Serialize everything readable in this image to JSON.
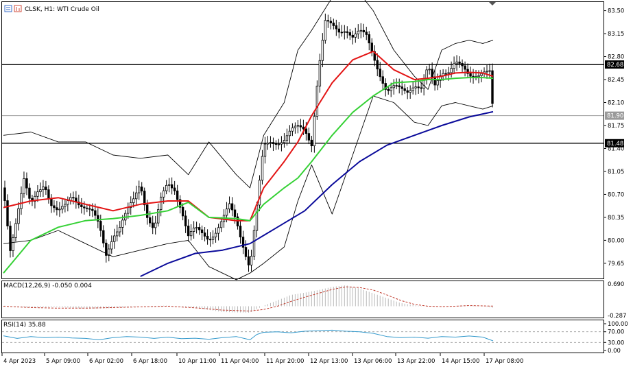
{
  "window": {
    "title": "CLSK, H1:  WTI Crude Oil",
    "icons": [
      "chart-toolbar-icon",
      "chart-bars-icon"
    ]
  },
  "price_scale": {
    "ticks": [
      "83.50",
      "83.15",
      "82.80",
      "82.45",
      "82.10",
      "81.75",
      "81.40",
      "81.05",
      "80.70",
      "80.35",
      "80.00",
      "79.65"
    ],
    "tags": [
      {
        "label": "82.68",
        "value": 82.68,
        "style": "dark"
      },
      {
        "label": "81.90",
        "value": 81.9,
        "style": "gray"
      },
      {
        "label": "81.48",
        "value": 81.48,
        "style": "dark"
      }
    ]
  },
  "macd_panel": {
    "label": "MACD(12,26,9) -0.050 0.004",
    "ticks": [
      "0.690",
      "-0.287"
    ]
  },
  "rsi_panel": {
    "label": "RSI(14) 35.88",
    "ticks": [
      "100.00",
      "70.00",
      "30.00",
      "0.00"
    ]
  },
  "time_axis": [
    "4 Apr 2023",
    "5 Apr 09:00",
    "6 Apr 02:00",
    "6 Apr 18:00",
    "10 Apr 11:00",
    "11 Apr 04:00",
    "11 Apr 20:00",
    "12 Apr 13:00",
    "13 Apr 06:00",
    "13 Apr 22:00",
    "14 Apr 15:00",
    "17 Apr 08:00"
  ],
  "colors": {
    "sma_fast": "#e31414",
    "sma_mid": "#35d135",
    "sma_slow": "#0a0a9a",
    "bands": "#000000",
    "macd_signal": "#c0392b",
    "rsi": "#3399cc",
    "gray_level": "#9a9a9a",
    "hist": "#b9b9b9"
  },
  "chart_data": [
    {
      "type": "line",
      "title": "CLSK, H1:  WTI Crude Oil",
      "ylim": [
        79.45,
        83.6
      ],
      "horizontal_lines": [
        82.68,
        81.9,
        81.48
      ],
      "series": [
        {
          "role": "price_close",
          "x": [
            0,
            10,
            20,
            30,
            40,
            50,
            60,
            70,
            80,
            90,
            100,
            110,
            120,
            130,
            140,
            150,
            160,
            170,
            180,
            190,
            200,
            210,
            220,
            230,
            240,
            250,
            260,
            270,
            280,
            290,
            300,
            310,
            320,
            330,
            340,
            350,
            360,
            370,
            380,
            390,
            400,
            410,
            420,
            430,
            440,
            450,
            460,
            470,
            480,
            490,
            500,
            510,
            520,
            530,
            540,
            550,
            560,
            570,
            580,
            590,
            600,
            610,
            620,
            630,
            640,
            650,
            660,
            670,
            680,
            690,
            700,
            710,
            715
          ],
          "values": [
            80.8,
            79.9,
            80.4,
            80.9,
            80.5,
            80.75,
            80.9,
            80.55,
            80.4,
            80.5,
            80.7,
            80.6,
            80.5,
            80.4,
            80.2,
            79.8,
            80.1,
            80.2,
            80.4,
            80.6,
            80.9,
            80.4,
            80.15,
            80.6,
            80.85,
            80.8,
            80.5,
            80.05,
            80.15,
            80.1,
            80.05,
            80.15,
            80.3,
            80.5,
            80.3,
            79.95,
            79.6,
            80.5,
            81.4,
            81.5,
            81.52,
            81.55,
            81.65,
            81.7,
            81.7,
            81.5,
            82.6,
            83.3,
            83.25,
            83.2,
            83.25,
            83.1,
            83.15,
            83.1,
            82.85,
            82.55,
            82.25,
            82.3,
            82.3,
            82.3,
            82.4,
            82.3,
            82.6,
            82.35,
            82.6,
            82.6,
            82.7,
            82.6,
            82.5,
            82.55,
            82.6,
            82.55,
            81.9
          ]
        },
        {
          "role": "bb_upper",
          "x": [
            0,
            40,
            80,
            120,
            160,
            200,
            240,
            270,
            300,
            340,
            360,
            380,
            410,
            430,
            450,
            480,
            510,
            540,
            570,
            600,
            620,
            640,
            660,
            680,
            700,
            715
          ],
          "values": [
            81.6,
            81.65,
            81.5,
            81.5,
            81.3,
            81.25,
            81.3,
            81.0,
            81.5,
            81.0,
            80.8,
            81.6,
            82.1,
            82.9,
            83.2,
            83.7,
            83.9,
            83.5,
            82.9,
            82.5,
            82.3,
            82.9,
            83.0,
            83.05,
            83.0,
            83.05
          ]
        },
        {
          "role": "bb_middle",
          "x": [
            0,
            40,
            80,
            120,
            160,
            200,
            240,
            270,
            300,
            340,
            360,
            380,
            410,
            430,
            450,
            480,
            510,
            540,
            570,
            600,
            620,
            640,
            660,
            680,
            700,
            715
          ],
          "values": [
            80.5,
            80.6,
            80.65,
            80.55,
            80.45,
            80.55,
            80.6,
            80.6,
            80.35,
            80.3,
            80.3,
            80.8,
            81.2,
            81.5,
            81.9,
            82.4,
            82.75,
            82.88,
            82.6,
            82.45,
            82.47,
            82.5,
            82.55,
            82.56,
            82.55,
            82.5
          ]
        },
        {
          "role": "bb_lower",
          "x": [
            0,
            40,
            80,
            120,
            160,
            200,
            240,
            270,
            300,
            340,
            360,
            380,
            410,
            430,
            450,
            480,
            510,
            540,
            570,
            600,
            620,
            640,
            660,
            680,
            700,
            715
          ],
          "values": [
            79.95,
            80.0,
            80.15,
            79.95,
            79.75,
            79.85,
            79.95,
            80.0,
            79.6,
            79.4,
            79.5,
            79.65,
            79.9,
            80.6,
            81.15,
            80.4,
            81.3,
            82.2,
            82.1,
            81.8,
            81.75,
            82.05,
            82.1,
            82.05,
            82.0,
            82.05
          ]
        },
        {
          "role": "ma_mid",
          "x": [
            0,
            40,
            80,
            120,
            160,
            200,
            240,
            270,
            300,
            340,
            360,
            380,
            410,
            430,
            450,
            480,
            510,
            540,
            570,
            600,
            620,
            640,
            660,
            680,
            700,
            715
          ],
          "values": [
            79.5,
            80.0,
            80.2,
            80.3,
            80.33,
            80.38,
            80.45,
            80.58,
            80.35,
            80.33,
            80.3,
            80.55,
            80.8,
            80.95,
            81.2,
            81.6,
            81.95,
            82.2,
            82.4,
            82.42,
            82.45,
            82.45,
            82.47,
            82.48,
            82.48,
            82.47
          ]
        },
        {
          "role": "ma_slow",
          "x": [
            200,
            240,
            280,
            320,
            360,
            400,
            440,
            480,
            520,
            560,
            600,
            640,
            680,
            715
          ],
          "values": [
            79.45,
            79.65,
            79.8,
            79.85,
            79.95,
            80.2,
            80.45,
            80.85,
            81.2,
            81.45,
            81.6,
            81.75,
            81.88,
            81.96
          ]
        }
      ]
    },
    {
      "type": "bar",
      "title": "MACD(12,26,9) -0.050 0.004",
      "ylim": [
        -0.287,
        0.69
      ],
      "series": [
        {
          "role": "macd_histogram",
          "x": [
            0,
            40,
            80,
            120,
            160,
            200,
            240,
            280,
            320,
            360,
            380,
            400,
            420,
            440,
            460,
            480,
            500,
            520,
            540,
            560,
            580,
            600,
            620,
            640,
            660,
            680,
            700,
            715
          ],
          "values": [
            0.02,
            -0.05,
            -0.02,
            -0.08,
            -0.06,
            0.0,
            0.02,
            -0.05,
            -0.18,
            -0.2,
            0.02,
            0.18,
            0.35,
            0.42,
            0.5,
            0.6,
            0.65,
            0.55,
            0.4,
            0.25,
            0.1,
            0.03,
            -0.01,
            0.0,
            0.01,
            0.02,
            0.0,
            -0.05
          ]
        },
        {
          "role": "macd_signal",
          "x": [
            0,
            40,
            80,
            120,
            160,
            200,
            240,
            280,
            320,
            360,
            380,
            400,
            420,
            440,
            460,
            480,
            500,
            520,
            540,
            560,
            580,
            600,
            620,
            640,
            660,
            680,
            700,
            715
          ],
          "values": [
            0.0,
            -0.04,
            -0.06,
            -0.06,
            -0.04,
            -0.02,
            0.0,
            -0.05,
            -0.12,
            -0.15,
            -0.1,
            0.0,
            0.15,
            0.28,
            0.4,
            0.52,
            0.6,
            0.58,
            0.5,
            0.35,
            0.18,
            0.06,
            0.0,
            -0.01,
            0.0,
            0.02,
            0.01,
            0.004
          ]
        }
      ]
    },
    {
      "type": "line",
      "title": "RSI(14) 35.88",
      "ylim": [
        0,
        100
      ],
      "levels": [
        70,
        30
      ],
      "series": [
        {
          "role": "rsi",
          "x": [
            0,
            20,
            40,
            60,
            80,
            100,
            120,
            140,
            160,
            180,
            200,
            220,
            240,
            260,
            280,
            300,
            320,
            340,
            360,
            370,
            380,
            400,
            420,
            440,
            460,
            480,
            500,
            520,
            540,
            560,
            580,
            600,
            620,
            640,
            660,
            680,
            700,
            715
          ],
          "values": [
            55,
            45,
            52,
            48,
            50,
            47,
            45,
            40,
            48,
            52,
            50,
            45,
            50,
            44,
            46,
            42,
            48,
            52,
            40,
            60,
            68,
            70,
            66,
            72,
            74,
            76,
            72,
            70,
            64,
            52,
            48,
            50,
            46,
            52,
            50,
            54,
            50,
            36
          ]
        }
      ]
    }
  ]
}
